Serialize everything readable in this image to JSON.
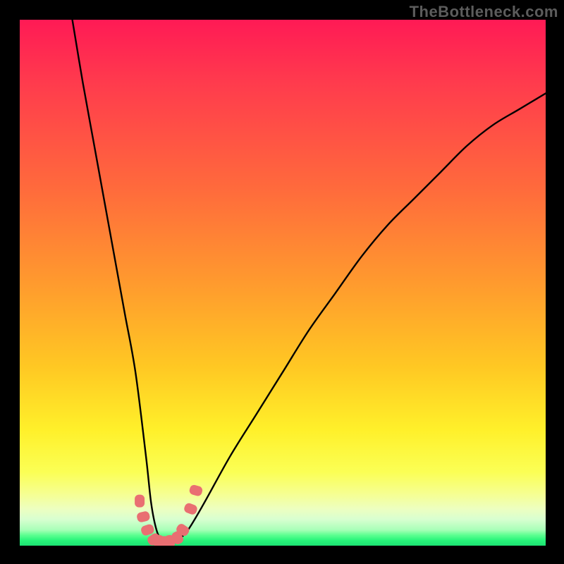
{
  "watermark": "TheBottleneck.com",
  "chart_data": {
    "type": "line",
    "title": "",
    "xlabel": "",
    "ylabel": "",
    "xlim": [
      0,
      100
    ],
    "ylim": [
      0,
      100
    ],
    "grid": false,
    "legend": false,
    "gradient_colors": {
      "top": "#ff1a55",
      "upper_mid": "#ff9a2e",
      "mid": "#fff02a",
      "lower": "#28f47a"
    },
    "series": [
      {
        "name": "bottleneck-curve",
        "color": "#000000",
        "x": [
          10,
          12,
          14,
          16,
          18,
          20,
          22,
          24,
          25,
          26,
          27,
          28,
          29,
          30,
          32,
          35,
          40,
          45,
          50,
          55,
          60,
          65,
          70,
          75,
          80,
          85,
          90,
          95,
          100
        ],
        "y": [
          100,
          88,
          77,
          66,
          55,
          44,
          33,
          17,
          8,
          3,
          1,
          0.5,
          0.5,
          1,
          3,
          8,
          17,
          25,
          33,
          41,
          48,
          55,
          61,
          66,
          71,
          76,
          80,
          83,
          86
        ]
      },
      {
        "name": "highlight-markers",
        "color": "#e96f72",
        "type": "scatter",
        "x": [
          22.8,
          23.5,
          24.3,
          25.5,
          26.5,
          27.5,
          28.5,
          30.0,
          31.0,
          32.5,
          33.5
        ],
        "y": [
          8.5,
          5.5,
          3.0,
          1.2,
          0.8,
          0.6,
          0.8,
          1.5,
          3.0,
          7.0,
          10.5
        ]
      }
    ]
  }
}
